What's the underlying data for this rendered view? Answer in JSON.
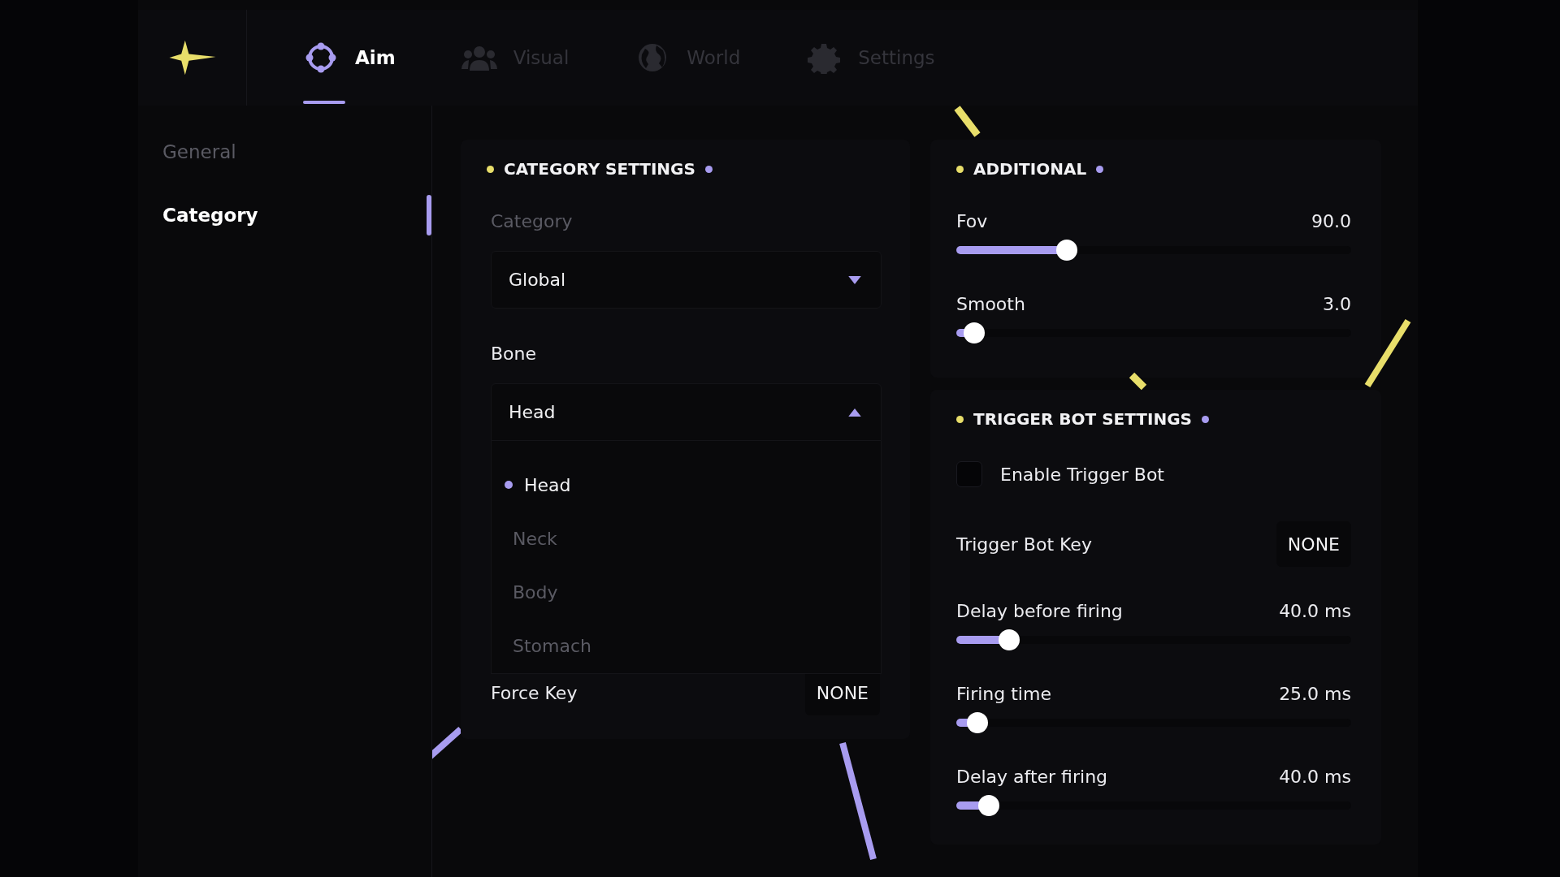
{
  "tabs": [
    {
      "label": "Aim",
      "selected": true
    },
    {
      "label": "Visual",
      "selected": false
    },
    {
      "label": "World",
      "selected": false
    },
    {
      "label": "Settings",
      "selected": false
    }
  ],
  "sidebar": {
    "items": [
      {
        "label": "General",
        "selected": false
      },
      {
        "label": "Category",
        "selected": true
      }
    ]
  },
  "category_settings": {
    "title": "CATEGORY SETTINGS",
    "fields": [
      {
        "kind": "select",
        "label": "Category",
        "disabled": true,
        "value": "Global",
        "expanded": false
      },
      {
        "kind": "select",
        "label": "Bone",
        "disabled": false,
        "value": "Head",
        "expanded": true,
        "options": [
          {
            "label": "Head",
            "selected": true
          },
          {
            "label": "Neck",
            "selected": false
          },
          {
            "label": "Body",
            "selected": false
          },
          {
            "label": "Stomach",
            "selected": false
          }
        ]
      },
      {
        "kind": "key",
        "label": "Force Key",
        "value": "NONE"
      }
    ]
  },
  "additional": {
    "title": "ADDITIONAL",
    "fields": [
      {
        "kind": "slider",
        "label": "Fov",
        "reading": "90.0",
        "level": 0.28
      },
      {
        "kind": "slider",
        "label": "Smooth",
        "reading": "3.0",
        "level": 0.045
      }
    ]
  },
  "trigger_bot_settings": {
    "title": "TRIGGER BOT SETTINGS",
    "fields": [
      {
        "kind": "checkbox",
        "label": "Enable Trigger Bot",
        "checked": false
      },
      {
        "kind": "key",
        "label": "Trigger Bot Key",
        "value": "NONE"
      },
      {
        "kind": "slider",
        "label": "Delay before firing",
        "reading": "40.0 ms",
        "level": 0.134
      },
      {
        "kind": "slider",
        "label": "Firing time",
        "reading": "25.0 ms",
        "level": 0.053
      },
      {
        "kind": "slider",
        "label": "Delay after firing",
        "reading": "40.0 ms",
        "level": 0.083
      }
    ]
  }
}
